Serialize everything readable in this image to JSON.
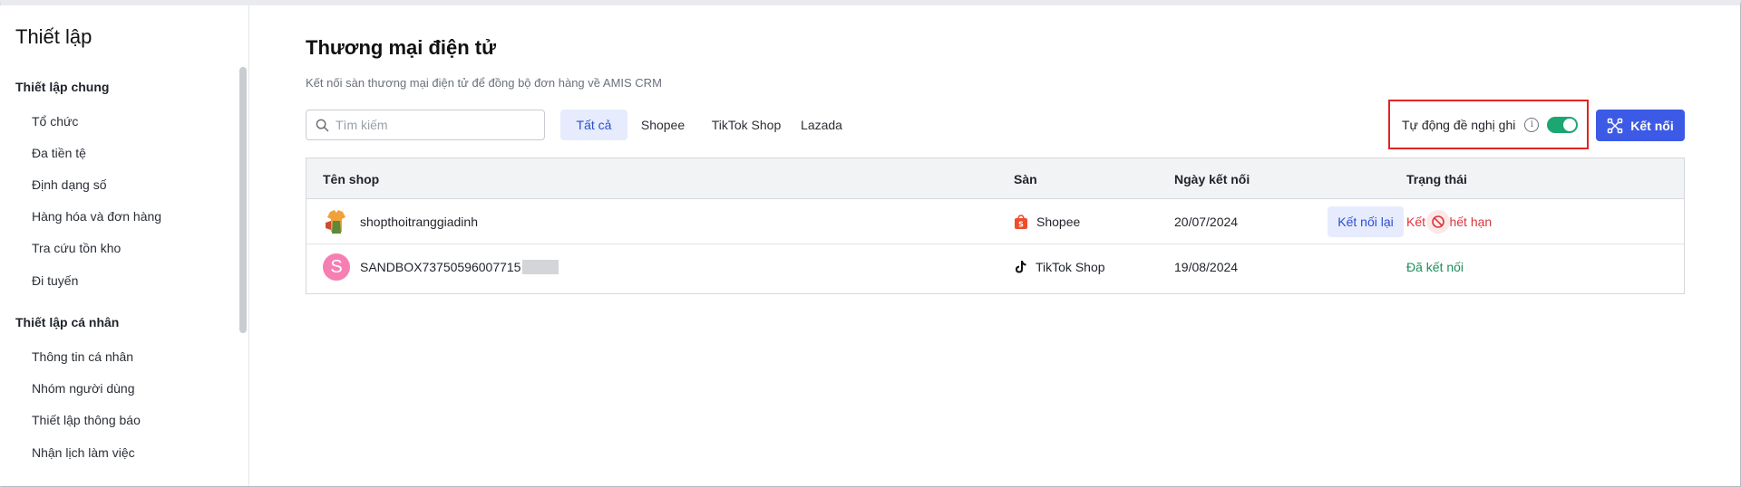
{
  "sidebar": {
    "title": "Thiết lập",
    "groups": [
      {
        "label": "Thiết lập chung",
        "items": [
          "Tổ chức",
          "Đa tiền tệ",
          "Định dạng số",
          "Hàng hóa và đơn hàng",
          "Tra cứu tồn kho",
          "Đi tuyến"
        ]
      },
      {
        "label": "Thiết lập cá nhân",
        "items": [
          "Thông tin cá nhân",
          "Nhóm người dùng",
          "Thiết lập thông báo",
          "Nhận lịch làm việc"
        ]
      }
    ]
  },
  "main": {
    "title": "Thương mại điện tử",
    "description": "Kết nối sàn thương mại điện tử để đồng bộ đơn hàng về AMIS CRM",
    "search": {
      "placeholder": "Tìm kiếm",
      "value": ""
    },
    "tabs": [
      {
        "label": "Tất cả",
        "active": true
      },
      {
        "label": "Shopee",
        "active": false
      },
      {
        "label": "TikTok Shop",
        "active": false
      },
      {
        "label": "Lazada",
        "active": false
      }
    ],
    "auto_suggest": {
      "label": "Tự động đề nghị ghi",
      "enabled": true
    },
    "connect_button": "Kết nối",
    "table": {
      "columns": [
        "Tên shop",
        "Sàn",
        "Ngày kết nối",
        "Trạng thái"
      ],
      "rows": [
        {
          "shop": "shopthoitranggiadinh",
          "platform": "Shopee",
          "date": "20/07/2024",
          "status": "Kết nối hết hạn",
          "action": "Kết nối lại"
        },
        {
          "shop": "SANDBOX73750596007715",
          "avatar_letter": "S",
          "platform": "TikTok Shop",
          "date": "19/08/2024",
          "status": "Đã kết nối"
        }
      ]
    }
  },
  "colors": {
    "primary": "#3d5ae6",
    "active_tab_bg": "#e6ecfd",
    "toggle_on": "#1ba672",
    "status_expired": "#d9363e",
    "status_connected": "#1e8e5a",
    "highlight_border": "#e02424"
  }
}
